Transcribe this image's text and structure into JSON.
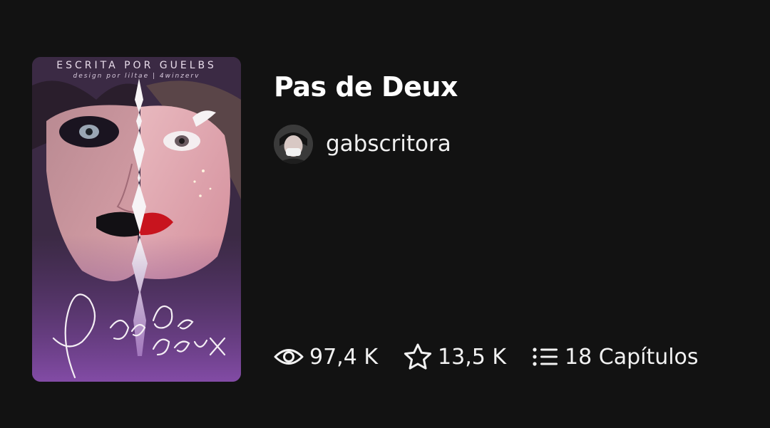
{
  "story": {
    "title": "Pas de Deux",
    "cover": {
      "credit_text": "ESCRITA POR GUELBS",
      "designer_text": "design por liltae | 4winzerv",
      "script_title": "Pas de deux"
    },
    "author": {
      "username": "gabscritora"
    },
    "stats": {
      "views": "97,4 K",
      "votes": "13,5 K",
      "chapters": "18 Capítulos"
    }
  },
  "icons": {
    "views": "eye-icon",
    "votes": "star-icon",
    "chapters": "list-icon"
  },
  "colors": {
    "background": "#121212",
    "text": "#ffffff"
  }
}
